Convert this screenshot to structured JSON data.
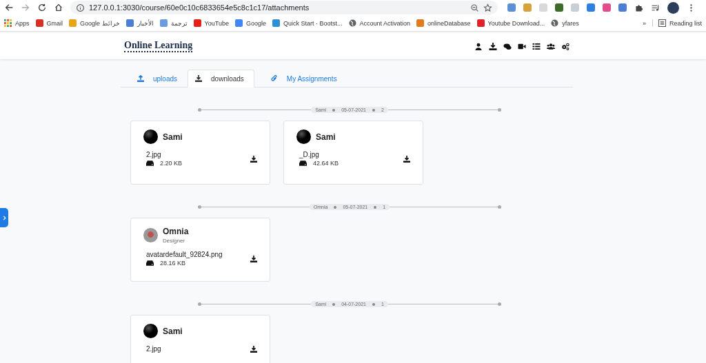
{
  "browser": {
    "address": "127.0.0.1:3030/course/60e0c10c6833654e5c8c1c17/attachments",
    "extensions": [
      {
        "color": "#5b8fd6"
      },
      {
        "color": "#d8a23a"
      },
      {
        "color": "#d9d9d9"
      },
      {
        "color": "#3f6b2a"
      },
      {
        "color": "#c9cfd6"
      },
      {
        "color": "#2f7fe0"
      },
      {
        "color": "#e34b8b"
      },
      {
        "color": "#4a7fd4"
      }
    ],
    "bookmarks": [
      {
        "kind": "apps",
        "label": "Apps"
      },
      {
        "kind": "site",
        "label": "Gmail",
        "color": "#d93025"
      },
      {
        "kind": "site",
        "label": "Google خرائط",
        "color": "#e8a317"
      },
      {
        "kind": "site",
        "label": "الأخبار",
        "color": "#4a7fd4"
      },
      {
        "kind": "site",
        "label": "ترجمة",
        "color": "#6c9be0"
      },
      {
        "kind": "site",
        "label": "YouTube",
        "color": "#e62117"
      },
      {
        "kind": "site",
        "label": "Google",
        "color": "#4285f4"
      },
      {
        "kind": "site",
        "label": "Quick Start · Bootst...",
        "color": "#2d8fd5"
      },
      {
        "kind": "globe",
        "label": "Account Activation"
      },
      {
        "kind": "site",
        "label": "onlineDatabase",
        "color": "#e07b20"
      },
      {
        "kind": "site",
        "label": "Youtube Download...",
        "color": "#e0222a"
      },
      {
        "kind": "globe",
        "label": "yfares"
      }
    ],
    "more": "»",
    "reading_list": "Reading list"
  },
  "site": {
    "logo": "Online Learning"
  },
  "tabs": [
    {
      "label": "uploads",
      "selected": false
    },
    {
      "label": "downloads",
      "selected": true
    },
    {
      "label": "My Assignments",
      "selected": false
    }
  ],
  "groups": [
    {
      "author": "Sami",
      "date": "05-07-2021",
      "count": "2",
      "files": [
        {
          "user": "Sami",
          "kind": "dark",
          "name": "2.jpg",
          "size": "2.20 KB"
        },
        {
          "user": "Sami",
          "kind": "dark",
          "name": "_D.jpg",
          "size": "42.64 KB"
        }
      ]
    },
    {
      "author": "Omnia",
      "date": "05-07-2021",
      "count": "1",
      "files": [
        {
          "user": "Omnia",
          "role": "Designer",
          "kind": "photo",
          "name": "avatardefault_92824.png",
          "size": "28.16 KB"
        }
      ]
    },
    {
      "author": "Sami",
      "date": "04-07-2021",
      "count": "1",
      "files": [
        {
          "user": "Sami",
          "kind": "dark",
          "name": "2.jpg"
        }
      ]
    }
  ]
}
